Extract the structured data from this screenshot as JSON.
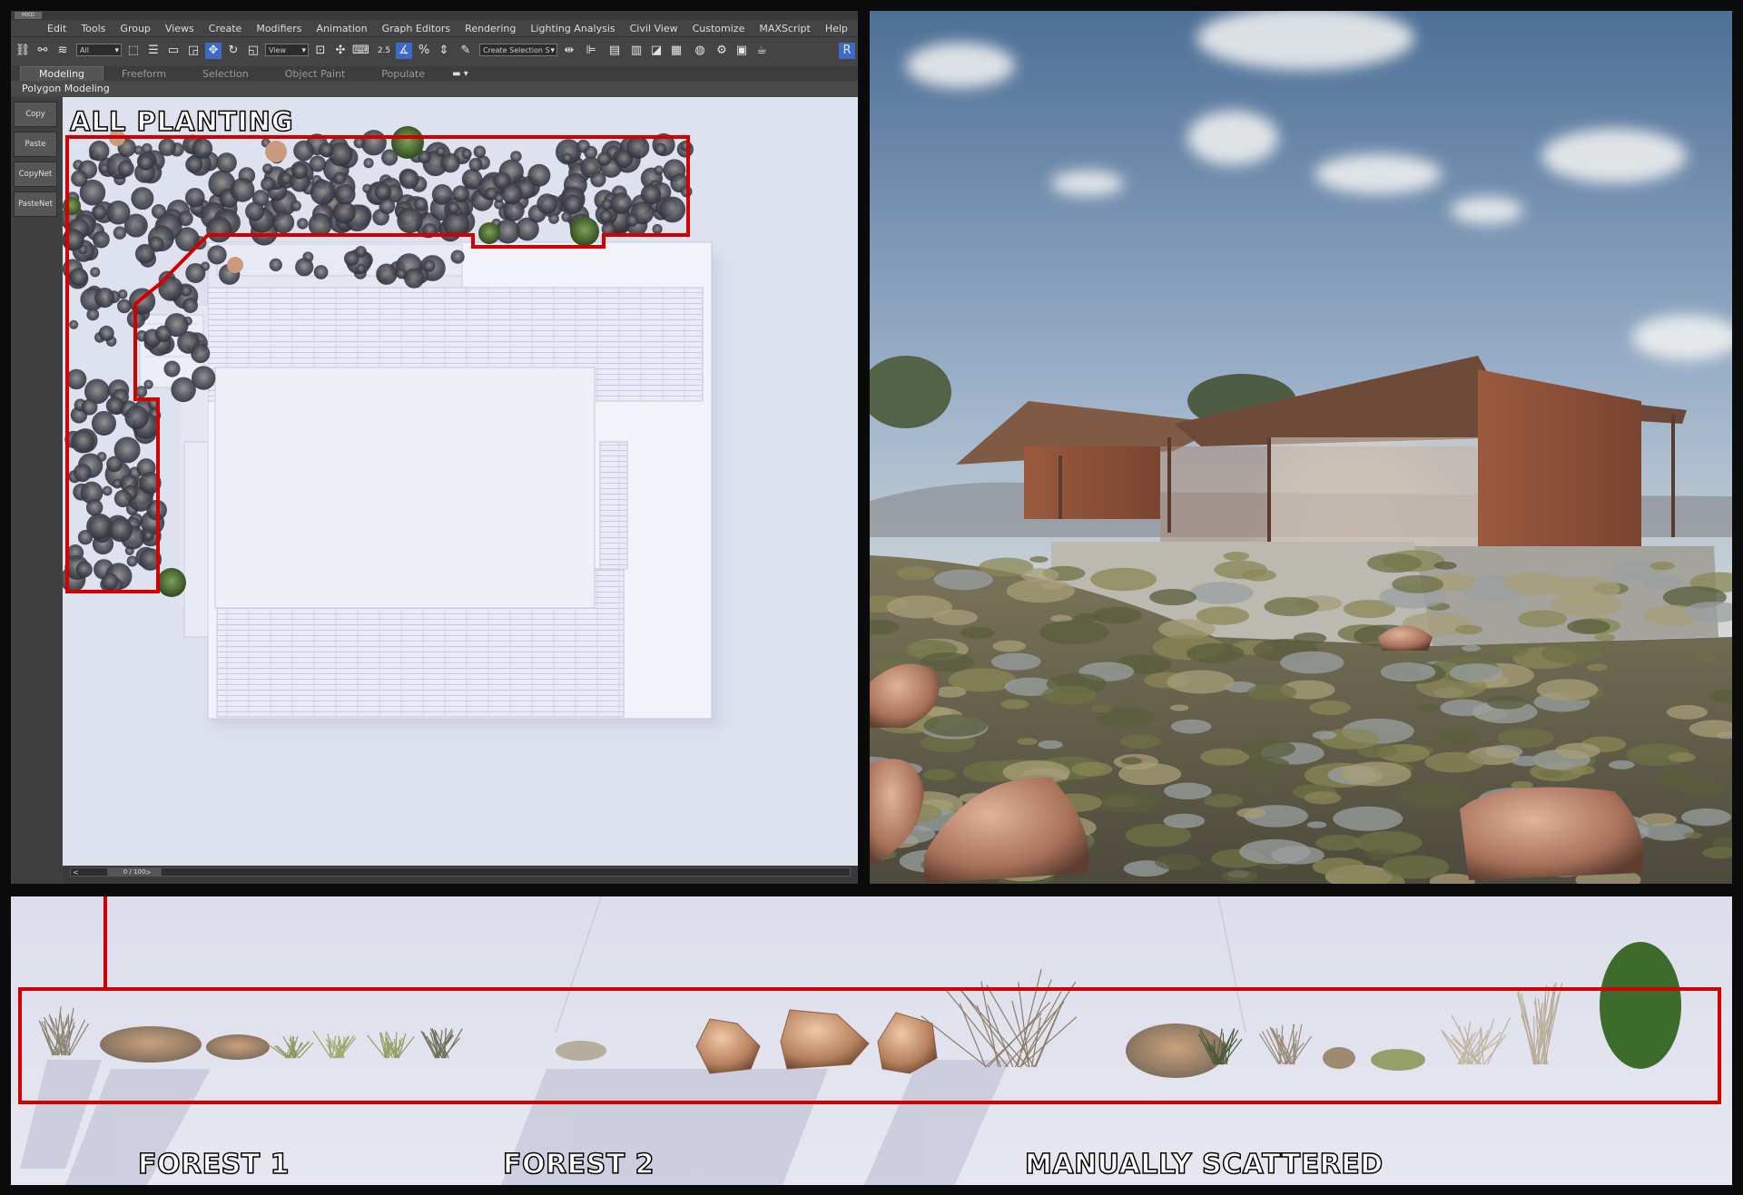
{
  "app": {
    "logo": "MXD",
    "menu": [
      "Edit",
      "Tools",
      "Group",
      "Views",
      "Create",
      "Modifiers",
      "Animation",
      "Graph Editors",
      "Rendering",
      "Lighting Analysis",
      "Civil View",
      "Customize",
      "MAXScript",
      "Help"
    ],
    "toolbar": {
      "filter_select": "All",
      "coord_select": "View",
      "selection_set_placeholder": "Create Selection S",
      "snap_label": "2.5"
    },
    "ribbon": {
      "tabs": [
        "Modeling",
        "Freeform",
        "Selection",
        "Object Paint",
        "Populate"
      ],
      "active_tab": "Modeling",
      "panel_label": "Polygon Modeling"
    },
    "sidebar": [
      "Copy",
      "Paste",
      "CopyNet",
      "PasteNet"
    ],
    "viewport": {
      "label": "ALL PLANTING"
    },
    "timeline": {
      "frame": "0 / 100",
      "prev": "<",
      "next": ">"
    }
  },
  "lineup": {
    "labels": {
      "forest1": "FOREST 1",
      "forest2": "FOREST 2",
      "manual": "MANUALLY SCATTERED"
    }
  },
  "colors": {
    "highlight": "#d40000",
    "viewport_bg": "#dfe2ef",
    "ui_dark": "#444444"
  }
}
